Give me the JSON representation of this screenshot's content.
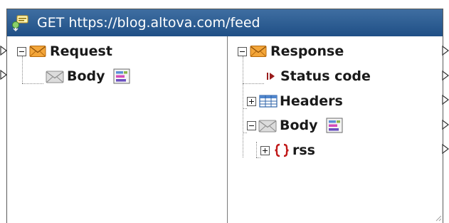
{
  "component": {
    "title": "GET https://blog.altova.com/feed"
  },
  "request": {
    "label": "Request",
    "body_label": "Body"
  },
  "response": {
    "label": "Response",
    "status_code_label": "Status code",
    "headers_label": "Headers",
    "body_label": "Body",
    "rss_label": "rss"
  },
  "icons": {
    "title": "rest-call-icon",
    "request": "envelope-icon",
    "response": "envelope-icon",
    "body": "envelope-gray-icon",
    "settings": "structure-settings-icon",
    "status": "status-arrow-icon",
    "headers": "table-icon",
    "rss": "json-braces-icon"
  },
  "colors": {
    "title_bar": "#2c5a90",
    "envelope": "#f3a63a",
    "braces": "#c01818",
    "status_arrow": "#9a1c1c"
  }
}
